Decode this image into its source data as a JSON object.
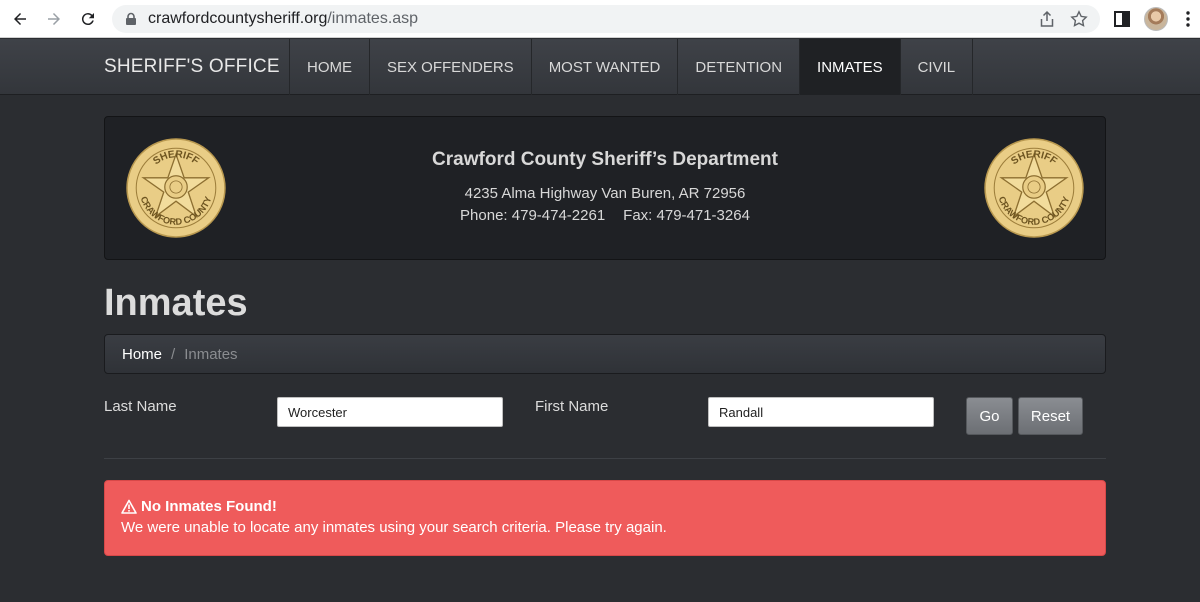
{
  "browser": {
    "url_host": "crawfordcountysheriff.org",
    "url_path": "/inmates.asp",
    "icons": [
      "back-arrow-icon",
      "forward-arrow-icon",
      "reload-icon",
      "lock-icon",
      "share-icon",
      "star-icon",
      "side-panel-icon",
      "profile-avatar",
      "more-menu-icon"
    ]
  },
  "navbar": {
    "brand": "SHERIFF'S OFFICE",
    "items": [
      {
        "label": "HOME"
      },
      {
        "label": "SEX OFFENDERS"
      },
      {
        "label": "MOST WANTED"
      },
      {
        "label": "DETENTION"
      },
      {
        "label": "INMATES",
        "active": true
      },
      {
        "label": "CIVIL"
      }
    ]
  },
  "banner": {
    "title": "Crawford County Sheriff’s Department",
    "address": "4235 Alma Highway Van Buren, AR 72956",
    "phone": "Phone: 479-474-2261",
    "fax": "Fax: 479-471-3264",
    "badge_text_top": "SHERIFF",
    "badge_text_bottom": "CRAWFORD COUNTY",
    "badge_color": "#e9cd86"
  },
  "page": {
    "title": "Inmates"
  },
  "breadcrumb": {
    "home": "Home",
    "separator": "/",
    "current": "Inmates"
  },
  "search": {
    "last_name_label": "Last Name",
    "last_name_value": "Worcester",
    "first_name_label": "First Name",
    "first_name_value": "Randall",
    "go_label": "Go",
    "reset_label": "Reset"
  },
  "alert": {
    "title": "No Inmates Found!",
    "message": "We were unable to locate any inmates using your search criteria. Please try again.",
    "color": "#ef5b5b"
  }
}
